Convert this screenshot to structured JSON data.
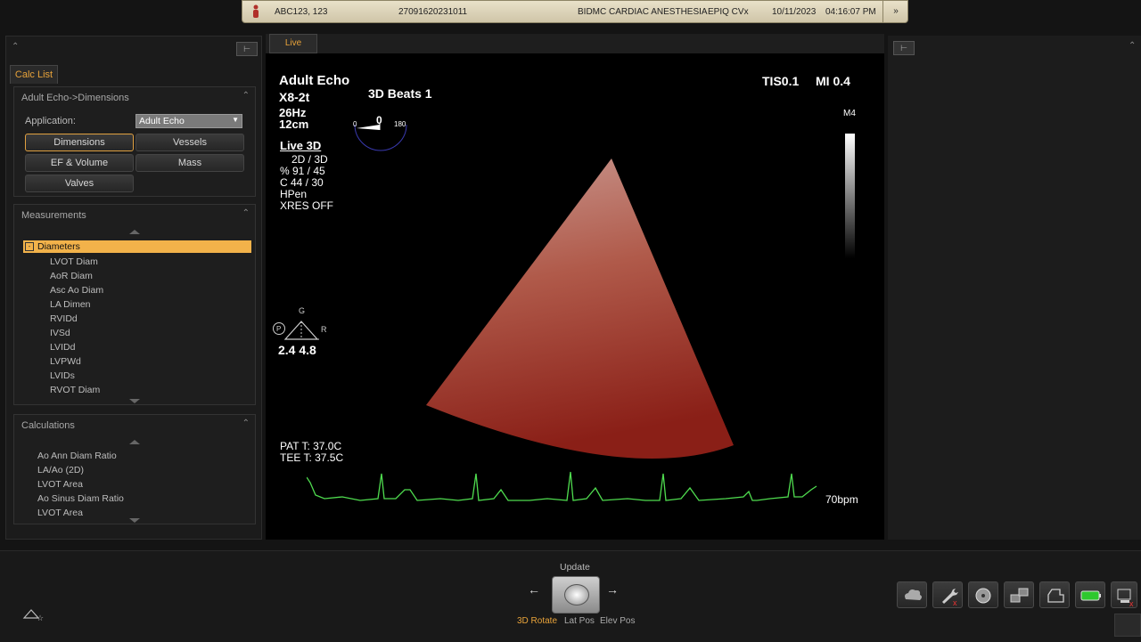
{
  "patient_bar": {
    "patient_name": "ABC123, 123",
    "patient_id": "27091620231011",
    "institution": "BIDMC CARDIAC ANESTHESIA",
    "system": "EPIQ CVx",
    "date": "10/11/2023",
    "time": "04:16:07 PM"
  },
  "calc_list": {
    "tab_label": "Calc List",
    "app_section_title": "Adult Echo->Dimensions",
    "application_label": "Application:",
    "application_value": "Adult Echo",
    "buttons": [
      "Dimensions",
      "Vessels",
      "EF & Volume",
      "Mass",
      "Valves"
    ],
    "active_button": "Dimensions"
  },
  "measurements": {
    "title": "Measurements",
    "group": "Diameters",
    "items": [
      "LVOT Diam",
      "AoR Diam",
      "Asc Ao Diam",
      "LA Dimen",
      "RVIDd",
      "IVSd",
      "LVIDd",
      "LVPWd",
      "LVIDs",
      "RVOT Diam"
    ]
  },
  "calculations": {
    "title": "Calculations",
    "items": [
      "Ao Ann Diam Ratio",
      "LA/Ao (2D)",
      "LVOT Area",
      "Ao Sinus Diam Ratio",
      "LVOT Area"
    ]
  },
  "image": {
    "live_tab": "Live",
    "preset": "Adult Echo",
    "probe": "X8-2t",
    "frame_rate": "26Hz",
    "depth": "12cm",
    "beats": "3D Beats 1",
    "angle_min": "0",
    "angle_value": "0",
    "angle_max": "180",
    "tis": "TIS0.1",
    "mi": "MI 0.4",
    "map": "M4",
    "mode": "Live 3D",
    "params": [
      "2D / 3D",
      "% 91 / 45",
      "C  44 / 30",
      "HPen",
      "XRES OFF"
    ],
    "gain_label_g": "G",
    "gain_label_p": "P",
    "gain_label_r": "R",
    "gain_values": "2.4  4.8",
    "pat_temp": "PAT T: 37.0C",
    "tee_temp": "TEE T: 37.5C",
    "heart_rate": "70bpm"
  },
  "bottom": {
    "update_label": "Update",
    "controls": [
      "3D Rotate",
      "Lat Pos",
      "Elev Pos"
    ],
    "active_control": "3D Rotate"
  },
  "colors": {
    "accent": "#e8a33a",
    "ecg": "#4fdc4f",
    "volume_render": "#b0402e",
    "patient_bar": "#e3dbc1"
  },
  "icons": {
    "toolbar": [
      "cloud-icon",
      "wrench-icon",
      "disc-icon",
      "network-icon",
      "printer-icon",
      "battery-icon",
      "monitor-icon"
    ]
  }
}
